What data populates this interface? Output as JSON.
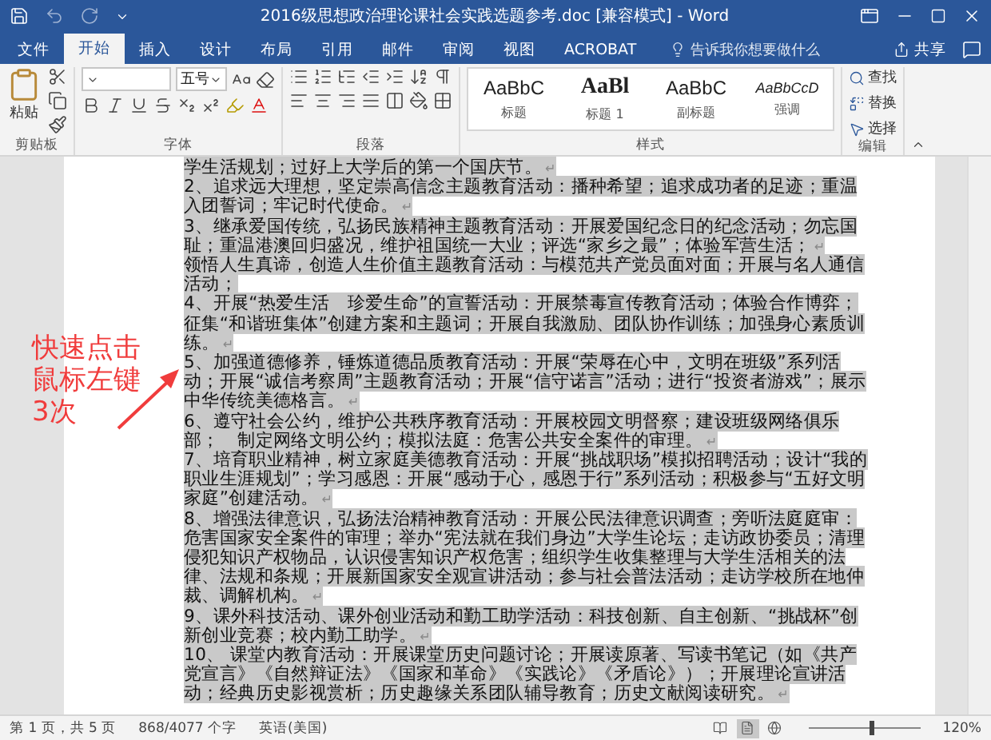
{
  "window": {
    "title": "2016级思想政治理论课社会实践选题参考.doc [兼容模式] - Word"
  },
  "tabs": [
    {
      "label": "文件",
      "selected": false
    },
    {
      "label": "开始",
      "selected": true
    },
    {
      "label": "插入",
      "selected": false
    },
    {
      "label": "设计",
      "selected": false
    },
    {
      "label": "布局",
      "selected": false
    },
    {
      "label": "引用",
      "selected": false
    },
    {
      "label": "邮件",
      "selected": false
    },
    {
      "label": "审阅",
      "selected": false
    },
    {
      "label": "视图",
      "selected": false
    },
    {
      "label": "ACROBAT",
      "selected": false
    }
  ],
  "tell_me": {
    "placeholder": "告诉我你想要做什么"
  },
  "share": {
    "label": "共享"
  },
  "ribbon": {
    "clipboard": {
      "paste": "粘贴",
      "label": "剪贴板"
    },
    "font": {
      "size": "五号",
      "label": "字体"
    },
    "paragraph": {
      "label": "段落"
    },
    "styles": {
      "label": "样式",
      "items": [
        {
          "preview": "AaBbC",
          "name": "标题",
          "kind": "normal"
        },
        {
          "preview": "AaBl",
          "name": "标题 1",
          "kind": "heading"
        },
        {
          "preview": "AaBbC",
          "name": "副标题",
          "kind": "subtitle"
        },
        {
          "preview": "AaBbCcD",
          "name": "强调",
          "kind": "emphasis"
        }
      ]
    },
    "editing": {
      "label": "编辑",
      "items": [
        {
          "label": "查找",
          "kind": "find"
        },
        {
          "label": "替换",
          "kind": "replace"
        },
        {
          "label": "选择",
          "kind": "select"
        }
      ]
    }
  },
  "document": {
    "paragraphs": [
      {
        "text": "学生活规划；过好上大学后的第一个国庆节。",
        "end": "↵",
        "selected": true
      },
      {
        "text": "2、追求远大理想，坚定崇高信念主题教育活动：播种希望；追求成功者的足迹；重温入团誓词；牢记时代使命。",
        "end": "↵",
        "selected": true
      },
      {
        "text": "3、继承爱国传统，弘扬民族精神主题教育活动：开展爱国纪念日的纪念活动；勿忘国耻；重温港澳回归盛况，维护祖国统一大业；评选“家乡之最”；体验军营生活；",
        "end": "↵",
        "selected": true
      },
      {
        "text": "领悟人生真谛，创造人生价值主题教育活动：与模范共产党员面对面；开展与名人通信活动；",
        "selected": true
      },
      {
        "text": "4、开展“热爱生活　珍爱生命”的宣誓活动：开展禁毒宣传教育活动；体验合作博弈；征集“和谐班集体”创建方案和主题词；开展自我激励、团队协作训练；加强身心素质训练。",
        "end": "↵",
        "selected": true
      },
      {
        "text": "5、加强道德修养，锤炼道德品质教育活动：开展“荣辱在心中，文明在班级”系列活动；开展“诚信考察周”主题教育活动；开展“信守诺言”活动；进行“投资者游戏”；展示中华传统美德格言。",
        "end": "↵",
        "selected": true
      },
      {
        "text": "6、遵守社会公约，维护公共秩序教育活动：开展校园文明督察；建设班级网络俱乐部；　制定网络文明公约；模拟法庭：危害公共安全案件的审理。",
        "end": "↵",
        "selected": true
      },
      {
        "text": "7、培育职业精神，树立家庭美德教育活动：开展“挑战职场”模拟招聘活动；设计“我的职业生涯规划”；学习感恩：开展“感动于心，感恩于行”系列活动；积极参与“五好文明家庭”创建活动。",
        "end": "↵",
        "selected": true
      },
      {
        "text": "8、增强法律意识，弘扬法治精神教育活动：开展公民法律意识调查；旁听法庭庭审：危害国家安全案件的审理；举办“宪法就在我们身边”大学生论坛；走访政协委员；清理侵犯知识产权物品，认识侵害知识产权危害；组织学生收集整理与大学生活相关的法律、法规和条规；开展新国家安全观宣讲活动；参与社会普法活动；走访学校所在地仲裁、调解机构。",
        "end": "↵",
        "selected": true
      },
      {
        "text": "9、课外科技活动、课外创业活动和勤工助学活动：科技创新、自主创新、“挑战杯”创新创业竞赛；校内勤工助学。",
        "end": "↵",
        "selected": true
      },
      {
        "text": "10、 课堂内教育活动：开展课堂历史问题讨论；开展读原著、写读书笔记（如《共产党宣言》《自然辩证法》《国家和革命》《实践论》《矛盾论》）；开展理论宣讲活动；经典历史影视赏析；历史趣缘关系团队辅导教育；历史文献阅读研究。",
        "end": "↵",
        "selected": true
      }
    ],
    "annotation": {
      "lines": [
        "快速点击",
        "鼠标左键",
        "3次"
      ]
    }
  },
  "status_bar": {
    "page": "第 1 页，共 5 页",
    "words": "868/4077 个字",
    "language": "英语(美国)",
    "views": [
      {
        "kind": "read",
        "selected": false
      },
      {
        "kind": "print",
        "selected": true
      },
      {
        "kind": "web",
        "selected": false
      }
    ],
    "zoom": {
      "level": 0.55,
      "reading": "120%"
    }
  }
}
